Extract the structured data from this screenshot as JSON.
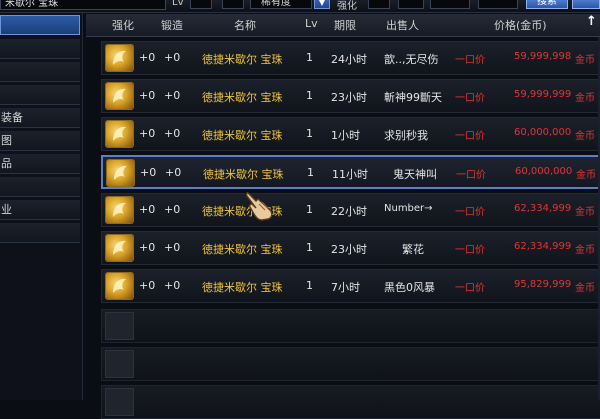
{
  "search": {
    "query": "米歇尔 宝珠"
  },
  "topbar": {
    "lv_label": "Lv",
    "rarity_value": "稀有度",
    "dropdown_glyph": "▼",
    "enhance_label": "强化",
    "search_button": "搜索"
  },
  "categories": [
    {
      "label": ""
    },
    {
      "label": ""
    },
    {
      "label": ""
    },
    {
      "label": ""
    },
    {
      "label": "装备"
    },
    {
      "label": "图"
    },
    {
      "label": "品"
    },
    {
      "label": ""
    },
    {
      "label": "业"
    },
    {
      "label": ""
    }
  ],
  "header": {
    "enhance": "强化",
    "forge": "锻造",
    "name": "名称",
    "lv": "Lv",
    "duration": "期限",
    "seller": "出售人",
    "price": "价格(金币)",
    "sort_glyph": "↑"
  },
  "listings": [
    {
      "enhance": "+0",
      "forge": "+0",
      "name": "徳捷米歇尔 宝珠",
      "lv": "1",
      "time": "24小时",
      "seller": "歆..,无尽伤",
      "bid_type": "一口价",
      "price": "59,999,998",
      "currency": "金币"
    },
    {
      "enhance": "+0",
      "forge": "+0",
      "name": "徳捷米歇尔 宝珠",
      "lv": "1",
      "time": "23小时",
      "seller": "斬神99斷天",
      "bid_type": "一口价",
      "price": "59,999,999",
      "currency": "金币"
    },
    {
      "enhance": "+0",
      "forge": "+0",
      "name": "徳捷米歇尔 宝珠",
      "lv": "1",
      "time": "1小时",
      "seller": "求别秒我",
      "bid_type": "一口价",
      "price": "60,000,000",
      "currency": "金币"
    },
    {
      "enhance": "+0",
      "forge": "+0",
      "name": "徳捷米歇尔 宝珠",
      "lv": "1",
      "time": "11小时",
      "seller": "鬼天神叫",
      "bid_type": "一口价",
      "price": "60,000,000",
      "currency": "金币"
    },
    {
      "enhance": "+0",
      "forge": "+0",
      "name": "徳捷米歇尔 宝珠",
      "lv": "1",
      "time": "22小时",
      "seller": "Number→",
      "bid_type": "一口价",
      "price": "62,334,999",
      "currency": "金币"
    },
    {
      "enhance": "+0",
      "forge": "+0",
      "name": "徳捷米歇尔 宝珠",
      "lv": "1",
      "time": "23小时",
      "seller": "繁花",
      "bid_type": "一口价",
      "price": "62,334,999",
      "currency": "金币"
    },
    {
      "enhance": "+0",
      "forge": "+0",
      "name": "徳捷米歇尔 宝珠",
      "lv": "1",
      "time": "7小时",
      "seller": "黑色0风暴",
      "bid_type": "一口价",
      "price": "95,829,999",
      "currency": "金币"
    }
  ],
  "icons": {
    "item_icon": "orb-item-icon",
    "cursor": "hand-cursor-icon"
  },
  "colors": {
    "item_name": "#f0c53a",
    "price": "#e33434",
    "selection": "#5b7fc4"
  }
}
